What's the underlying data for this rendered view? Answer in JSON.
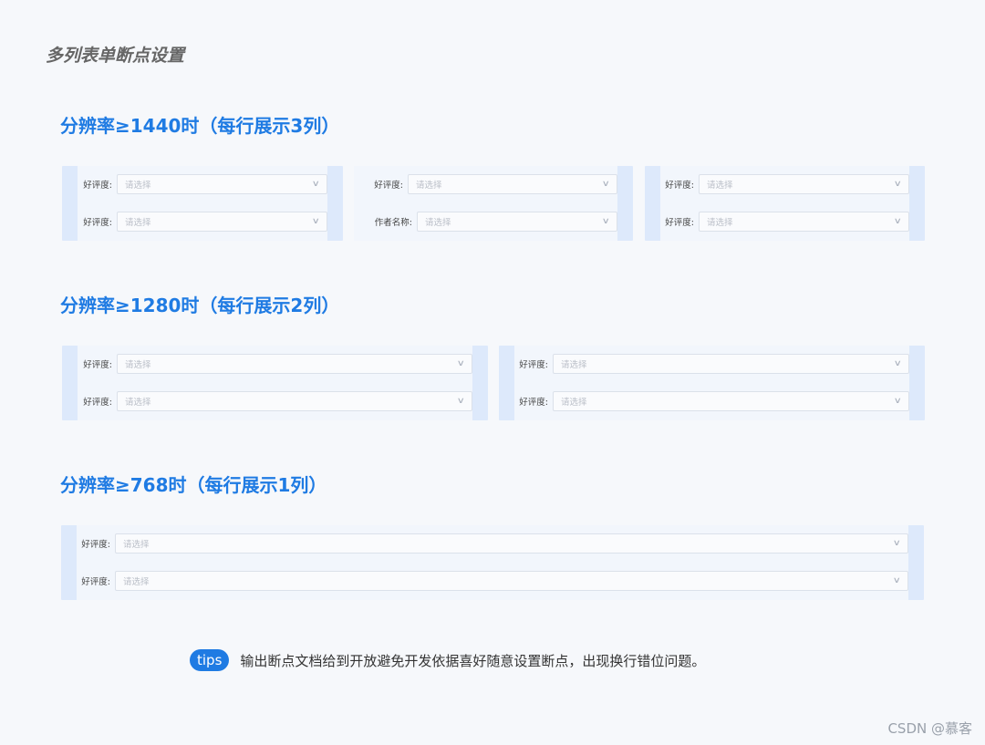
{
  "page": {
    "title": "多列表单断点设置"
  },
  "sections": [
    {
      "title": "分辨率≥1440时（每行展示3列）"
    },
    {
      "title": "分辨率≥1280时（每行展示2列）"
    },
    {
      "title": "分辨率≥768时（每行展示1列）"
    }
  ],
  "form": {
    "label_rating": "好评度:",
    "label_author": "作者名称:",
    "placeholder": "请选择",
    "dropdown_icon": "chevron-down-icon"
  },
  "tips": {
    "badge": "tips",
    "text": "输出断点文档给到开放避免开发依据喜好随意设置断点，出现换行错位问题。"
  },
  "watermark": "CSDN @慕客",
  "colors": {
    "accent": "#1f7be3",
    "panel": "#dde9fb"
  }
}
